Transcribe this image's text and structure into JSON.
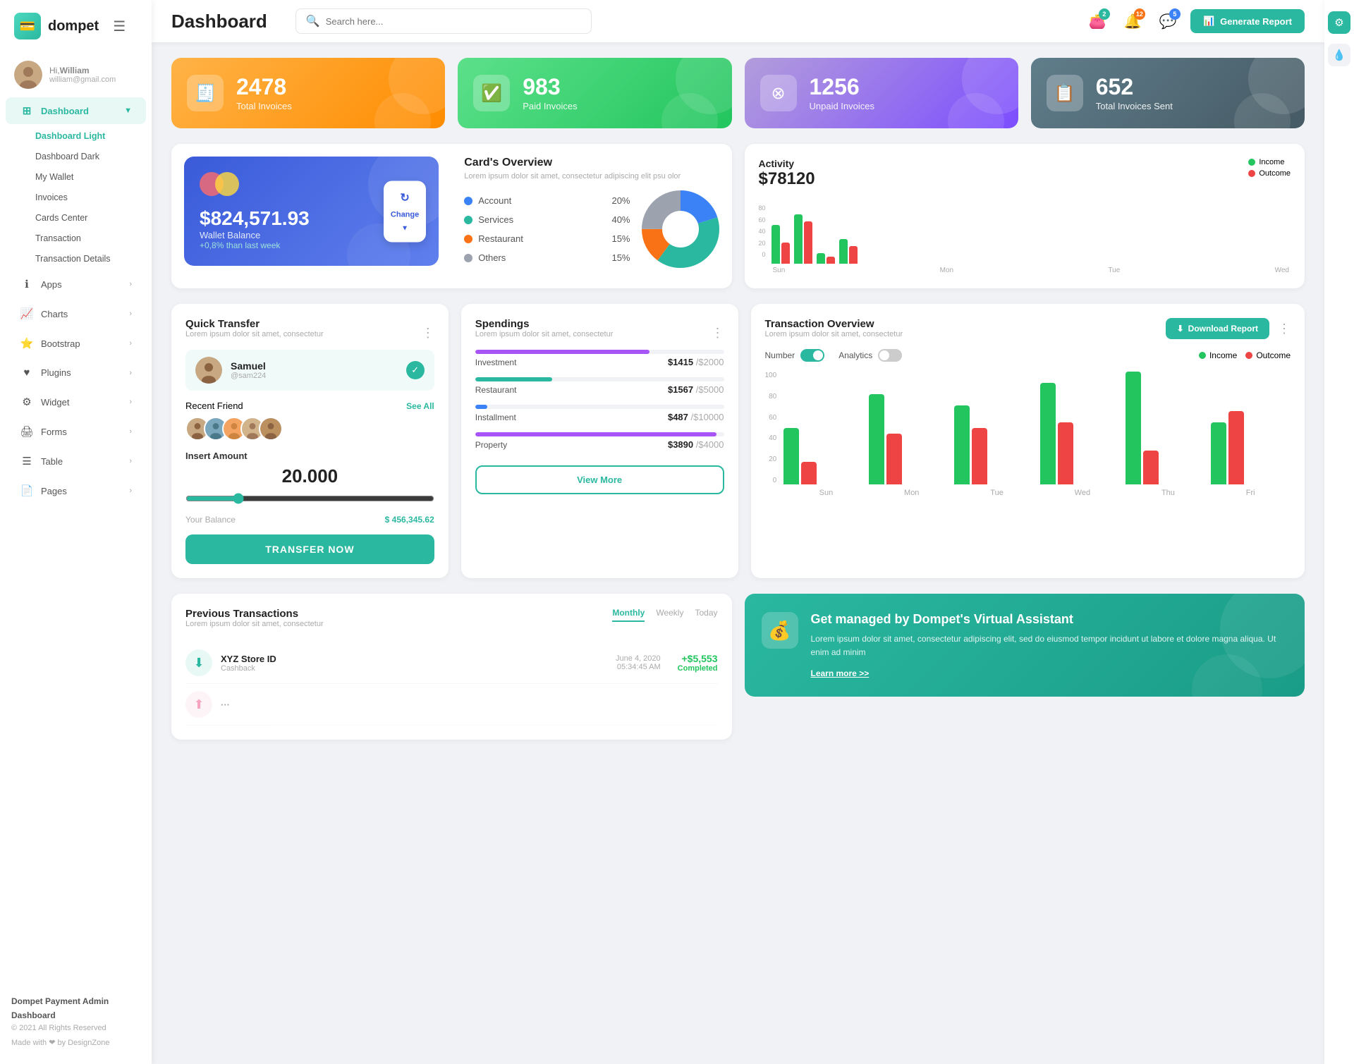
{
  "app": {
    "logo_text": "dompet",
    "logo_icon": "💳"
  },
  "user": {
    "greeting": "Hi,",
    "name": "William",
    "email": "william@gmail.com"
  },
  "header": {
    "title": "Dashboard",
    "search_placeholder": "Search here...",
    "generate_btn": "Generate Report",
    "badges": {
      "wallet": "2",
      "bell": "12",
      "chat": "5"
    }
  },
  "sidebar": {
    "nav_items": [
      {
        "label": "Dashboard",
        "icon": "⊞",
        "active": true,
        "arrow": "down"
      },
      {
        "label": "Apps",
        "icon": "ℹ",
        "arrow": "right"
      },
      {
        "label": "Charts",
        "icon": "📈",
        "arrow": "right"
      },
      {
        "label": "Bootstrap",
        "icon": "⭐",
        "arrow": "right"
      },
      {
        "label": "Plugins",
        "icon": "❤",
        "arrow": "right"
      },
      {
        "label": "Widget",
        "icon": "⚙",
        "arrow": "right"
      },
      {
        "label": "Forms",
        "icon": "🖨",
        "arrow": "right"
      },
      {
        "label": "Table",
        "icon": "☰",
        "arrow": "right"
      },
      {
        "label": "Pages",
        "icon": "📄",
        "arrow": "right"
      }
    ],
    "sub_items": [
      {
        "label": "Dashboard Light",
        "active": true
      },
      {
        "label": "Dashboard Dark"
      },
      {
        "label": "My Wallet"
      },
      {
        "label": "Invoices"
      },
      {
        "label": "Cards Center"
      },
      {
        "label": "Transaction"
      },
      {
        "label": "Transaction Details"
      }
    ]
  },
  "footer": {
    "company": "Dompet Payment Admin Dashboard",
    "year": "© 2021 All Rights Reserved",
    "made_with": "Made with ❤ by DesignZone"
  },
  "stat_cards": [
    {
      "number": "2478",
      "label": "Total Invoices",
      "type": "orange"
    },
    {
      "number": "983",
      "label": "Paid Invoices",
      "type": "green"
    },
    {
      "number": "1256",
      "label": "Unpaid Invoices",
      "type": "purple"
    },
    {
      "number": "652",
      "label": "Total Invoices Sent",
      "type": "blue-gray"
    }
  ],
  "wallet": {
    "balance": "$824,571.93",
    "label": "Wallet Balance",
    "change": "+0,8% than last week",
    "change_btn": "Change"
  },
  "cards_overview": {
    "title": "Card's Overview",
    "desc": "Lorem ipsum dolor sit amet, consectetur adipiscing elit psu olor",
    "items": [
      {
        "name": "Account",
        "pct": "20%",
        "color": "#3b82f6"
      },
      {
        "name": "Services",
        "pct": "40%",
        "color": "#2ab8a0"
      },
      {
        "name": "Restaurant",
        "pct": "15%",
        "color": "#f97316"
      },
      {
        "name": "Others",
        "pct": "15%",
        "color": "#9ca3af"
      }
    ]
  },
  "activity": {
    "title": "Activity",
    "amount": "$78120",
    "legend": [
      {
        "label": "Income",
        "color": "#22c55e"
      },
      {
        "label": "Outcome",
        "color": "#ef4444"
      }
    ],
    "bars": [
      {
        "label": "Sun",
        "income": 55,
        "outcome": 30
      },
      {
        "label": "Mon",
        "income": 70,
        "outcome": 60
      },
      {
        "label": "Tue",
        "income": 15,
        "outcome": 10
      },
      {
        "label": "Wed",
        "income": 35,
        "outcome": 25
      }
    ]
  },
  "quick_transfer": {
    "title": "Quick Transfer",
    "desc": "Lorem ipsum dolor sit amet, consectetur",
    "recipient": {
      "name": "Samuel",
      "id": "@sam224"
    },
    "recent_friend_label": "Recent Friend",
    "see_all": "See All",
    "insert_amount_label": "Insert Amount",
    "amount": "20.000",
    "balance_label": "Your Balance",
    "balance": "$ 456,345.62",
    "btn": "TRANSFER NOW"
  },
  "spendings": {
    "title": "Spendings",
    "desc": "Lorem ipsum dolor sit amet, consectetur",
    "items": [
      {
        "name": "Investment",
        "amount": "$1415",
        "limit": "$2000",
        "pct": 70,
        "color": "#a855f7"
      },
      {
        "name": "Restaurant",
        "amount": "$1567",
        "limit": "$5000",
        "pct": 31,
        "color": "#2ab8a0"
      },
      {
        "name": "Installment",
        "amount": "$487",
        "limit": "$10000",
        "pct": 5,
        "color": "#3b82f6"
      },
      {
        "name": "Property",
        "amount": "$3890",
        "limit": "$4000",
        "pct": 97,
        "color": "#a855f7"
      }
    ],
    "btn": "View More"
  },
  "tx_overview": {
    "title": "Transaction Overview",
    "desc": "Lorem ipsum dolor sit amet, consectetur",
    "download_btn": "Download Report",
    "toggle_number": "Number",
    "toggle_analytics": "Analytics",
    "legend": [
      {
        "label": "Income",
        "color": "#22c55e"
      },
      {
        "label": "Outcome",
        "color": "#ef4444"
      }
    ],
    "bars": [
      {
        "label": "Sun",
        "income": 50,
        "outcome": 20
      },
      {
        "label": "Mon",
        "income": 80,
        "outcome": 45
      },
      {
        "label": "Tue",
        "income": 70,
        "outcome": 50
      },
      {
        "label": "Wed",
        "income": 90,
        "outcome": 55
      },
      {
        "label": "Thu",
        "income": 100,
        "outcome": 30
      },
      {
        "label": "Fri",
        "income": 55,
        "outcome": 65
      }
    ],
    "y_axis": [
      "100",
      "80",
      "60",
      "40",
      "20",
      "0"
    ]
  },
  "prev_transactions": {
    "title": "Previous Transactions",
    "desc": "Lorem ipsum dolor sit amet, consectetur",
    "tabs": [
      "Monthly",
      "Weekly",
      "Today"
    ],
    "items": [
      {
        "name": "XYZ Store ID",
        "type": "Cashback",
        "date": "June 4, 2020",
        "time": "05:34:45 AM",
        "amount": "+$5,553",
        "status": "Completed"
      }
    ]
  },
  "virtual_assistant": {
    "title": "Get managed by Dompet's Virtual Assistant",
    "desc": "Lorem ipsum dolor sit amet, consectetur adipiscing elit, sed do eiusmod tempor incidunt ut labore et dolore magna aliqua. Ut enim ad minim",
    "link": "Learn more >>"
  }
}
